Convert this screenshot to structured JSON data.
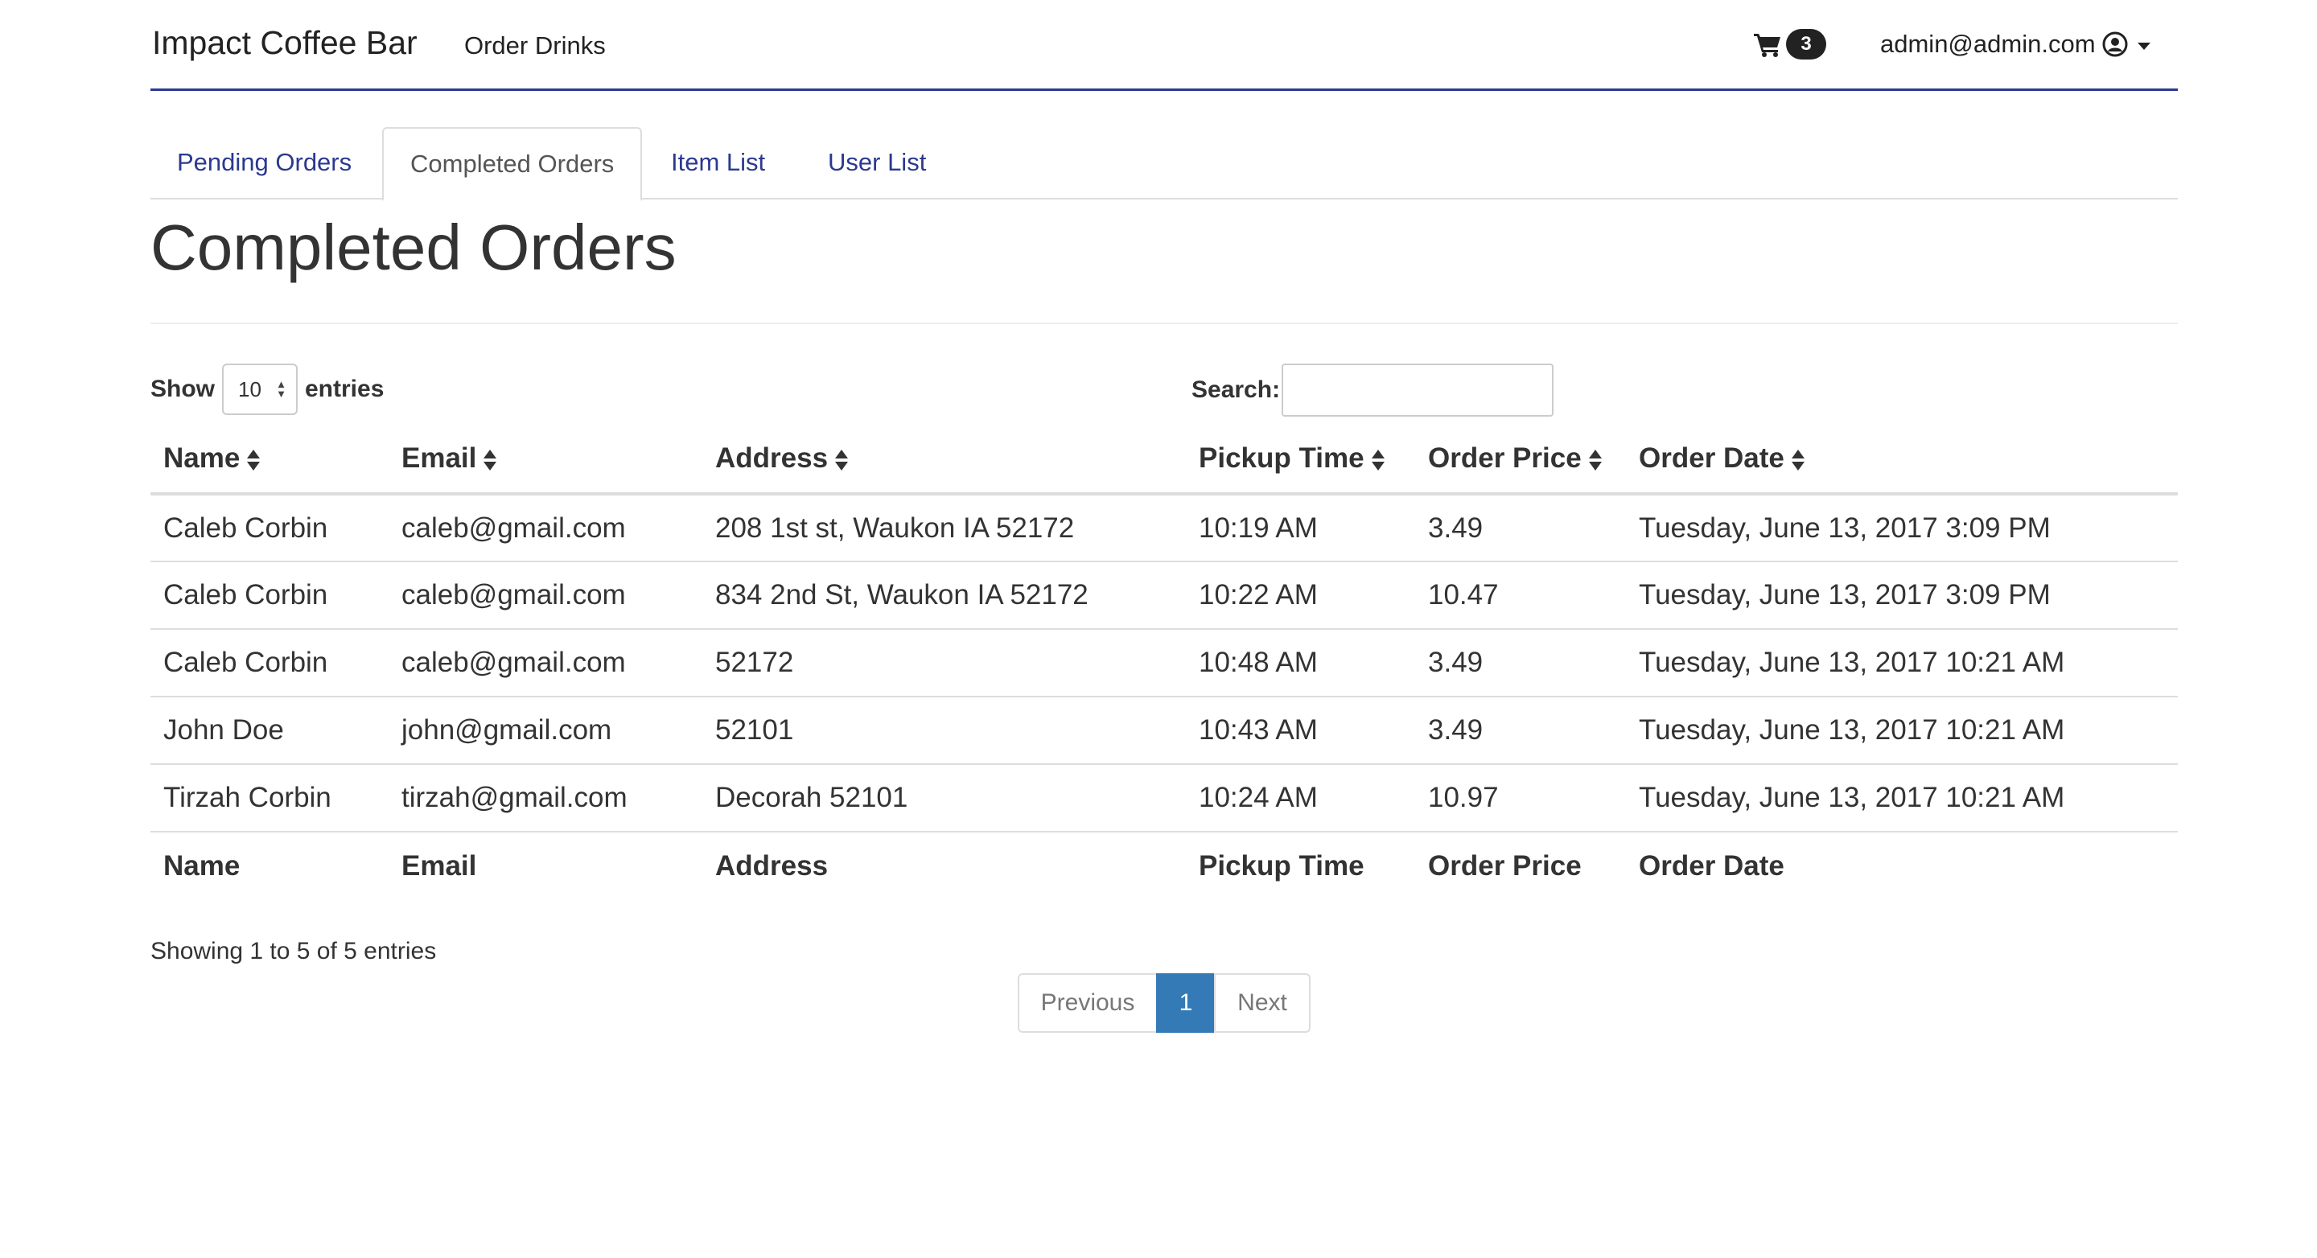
{
  "navbar": {
    "brand": "Impact Coffee Bar",
    "order_link": "Order Drinks",
    "cart_icon": "shopping-cart-icon",
    "cart_count": "3",
    "user_email": "admin@admin.com",
    "user_icon": "user-circle-icon"
  },
  "tabs": [
    {
      "label": "Pending Orders"
    },
    {
      "label": "Completed Orders"
    },
    {
      "label": "Item List"
    },
    {
      "label": "User List"
    }
  ],
  "page_title": "Completed Orders",
  "controls": {
    "show_label": "Show",
    "entries_value": "10",
    "entries_label": "entries",
    "search_label": "Search:",
    "search_value": ""
  },
  "table": {
    "columns": [
      "Name",
      "Email",
      "Address",
      "Pickup Time",
      "Order Price",
      "Order Date"
    ],
    "rows": [
      [
        "Caleb Corbin",
        "caleb@gmail.com",
        "208 1st st, Waukon IA 52172",
        "10:19 AM",
        "3.49",
        "Tuesday, June 13, 2017 3:09 PM"
      ],
      [
        "Caleb Corbin",
        "caleb@gmail.com",
        "834 2nd St, Waukon IA 52172",
        "10:22 AM",
        "10.47",
        "Tuesday, June 13, 2017 3:09 PM"
      ],
      [
        "Caleb Corbin",
        "caleb@gmail.com",
        "52172",
        "10:48 AM",
        "3.49",
        "Tuesday, June 13, 2017 10:21 AM"
      ],
      [
        "John Doe",
        "john@gmail.com",
        "52101",
        "10:43 AM",
        "3.49",
        "Tuesday, June 13, 2017 10:21 AM"
      ],
      [
        "Tirzah Corbin",
        "tirzah@gmail.com",
        "Decorah 52101",
        "10:24 AM",
        "10.97",
        "Tuesday, June 13, 2017 10:21 AM"
      ]
    ]
  },
  "info": "Showing 1 to 5 of 5 entries",
  "pagination": {
    "previous": "Previous",
    "current": "1",
    "next": "Next"
  },
  "colors": {
    "link": "#2b3990",
    "active_page": "#337ab7",
    "border": "#dddddd"
  }
}
